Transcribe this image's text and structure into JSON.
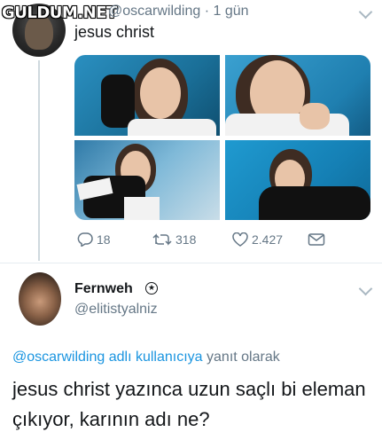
{
  "watermark": "GULDUM.NET",
  "tweet1": {
    "handle_time": "@oscarwilding · 1 gün",
    "text": "jesus christ",
    "actions": {
      "reply_count": "18",
      "retweet_count": "318",
      "like_count": "2.427"
    },
    "photos": [
      "photo-1",
      "photo-2",
      "photo-3",
      "photo-4"
    ]
  },
  "tweet2": {
    "name": "Fernweh",
    "handle": "@elitistyalniz",
    "reply_mention": "@oscarwilding adlı kullanıcıya",
    "reply_suffix": "yanıt olarak",
    "text": "jesus christ yazınca uzun saçlı bi eleman çıkıyor, karının adı ne?"
  },
  "colors": {
    "accent": "#1b95e0",
    "secondary_text": "#657786",
    "primary_text": "#14171a"
  }
}
